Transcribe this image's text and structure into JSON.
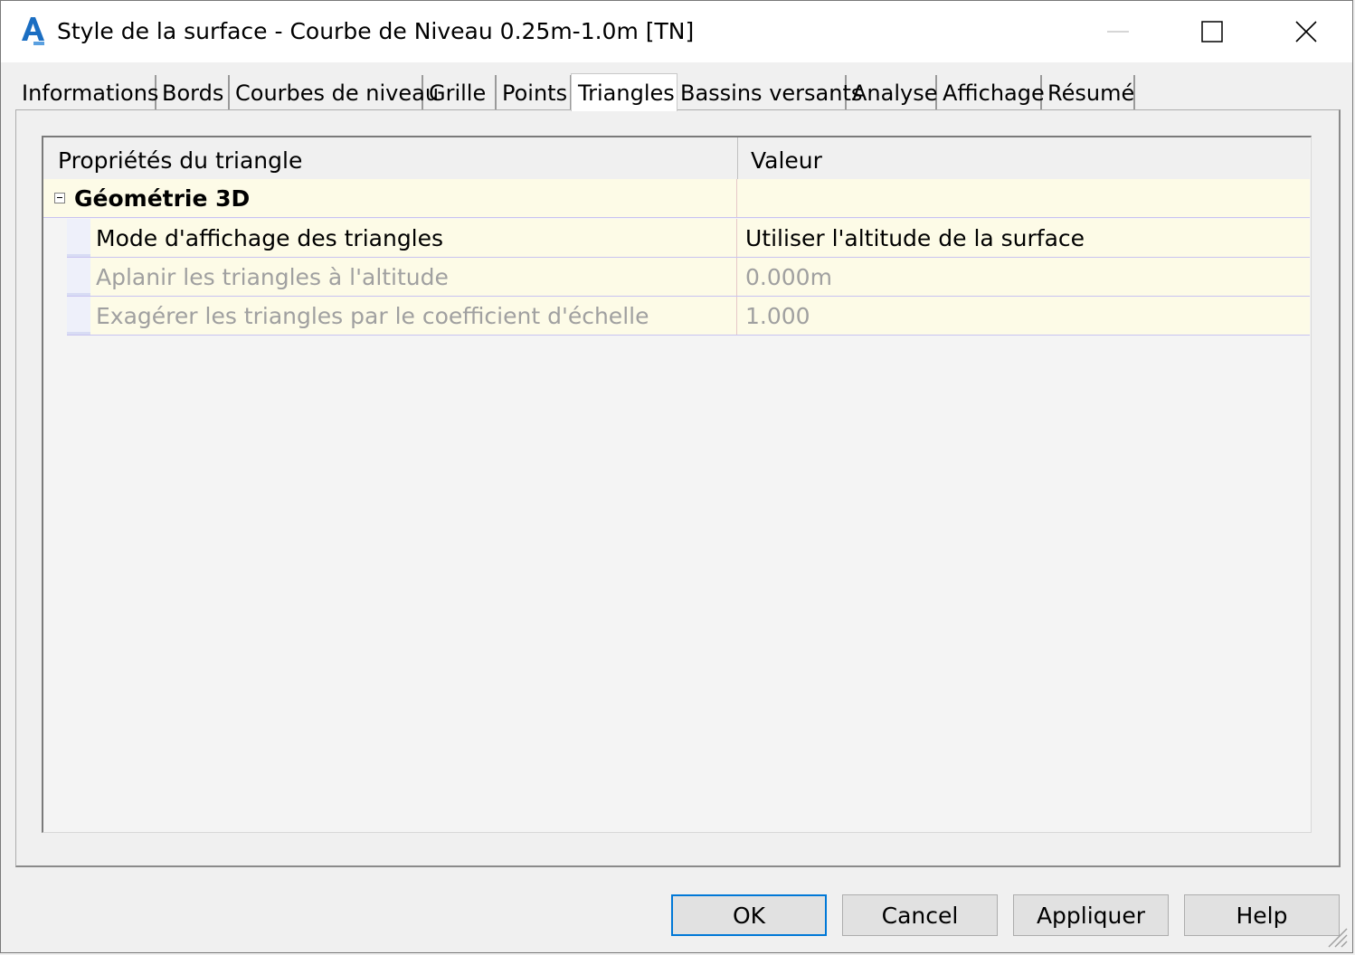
{
  "window": {
    "title": "Style de la surface - Courbe de Niveau 0.25m-1.0m [TN]",
    "icon": "autocad-civil-3d-app-icon",
    "controls": [
      "minimize-icon",
      "maximize-icon",
      "close-icon"
    ]
  },
  "tabs": [
    {
      "label": "Informations"
    },
    {
      "label": "Bords"
    },
    {
      "label": "Courbes de niveau"
    },
    {
      "label": "Grille"
    },
    {
      "label": "Points"
    },
    {
      "label": "Triangles",
      "active": true
    },
    {
      "label": "Bassins versants"
    },
    {
      "label": "Analyse"
    },
    {
      "label": "Affichage"
    },
    {
      "label": "Résumé"
    }
  ],
  "grid": {
    "headers": {
      "property": "Propriétés du triangle",
      "value": "Valeur"
    },
    "category": {
      "label": "Géométrie 3D",
      "expanded": true
    },
    "rows": [
      {
        "property": "Mode d'affichage des triangles",
        "value": "Utiliser l'altitude de la surface",
        "enabled": true
      },
      {
        "property": "Aplanir les triangles à l'altitude",
        "value": "0.000m",
        "enabled": false
      },
      {
        "property": "Exagérer les triangles par le coefficient d'échelle",
        "value": "1.000",
        "enabled": false
      }
    ]
  },
  "buttons": {
    "ok": "OK",
    "cancel": "Cancel",
    "apply": "Appliquer",
    "help": "Help"
  },
  "colors": {
    "default_button_border": "#0078d7",
    "row_background": "#fdfbe7",
    "disabled_text": "#a0a0a0",
    "app_icon": "#1b6ec2"
  }
}
